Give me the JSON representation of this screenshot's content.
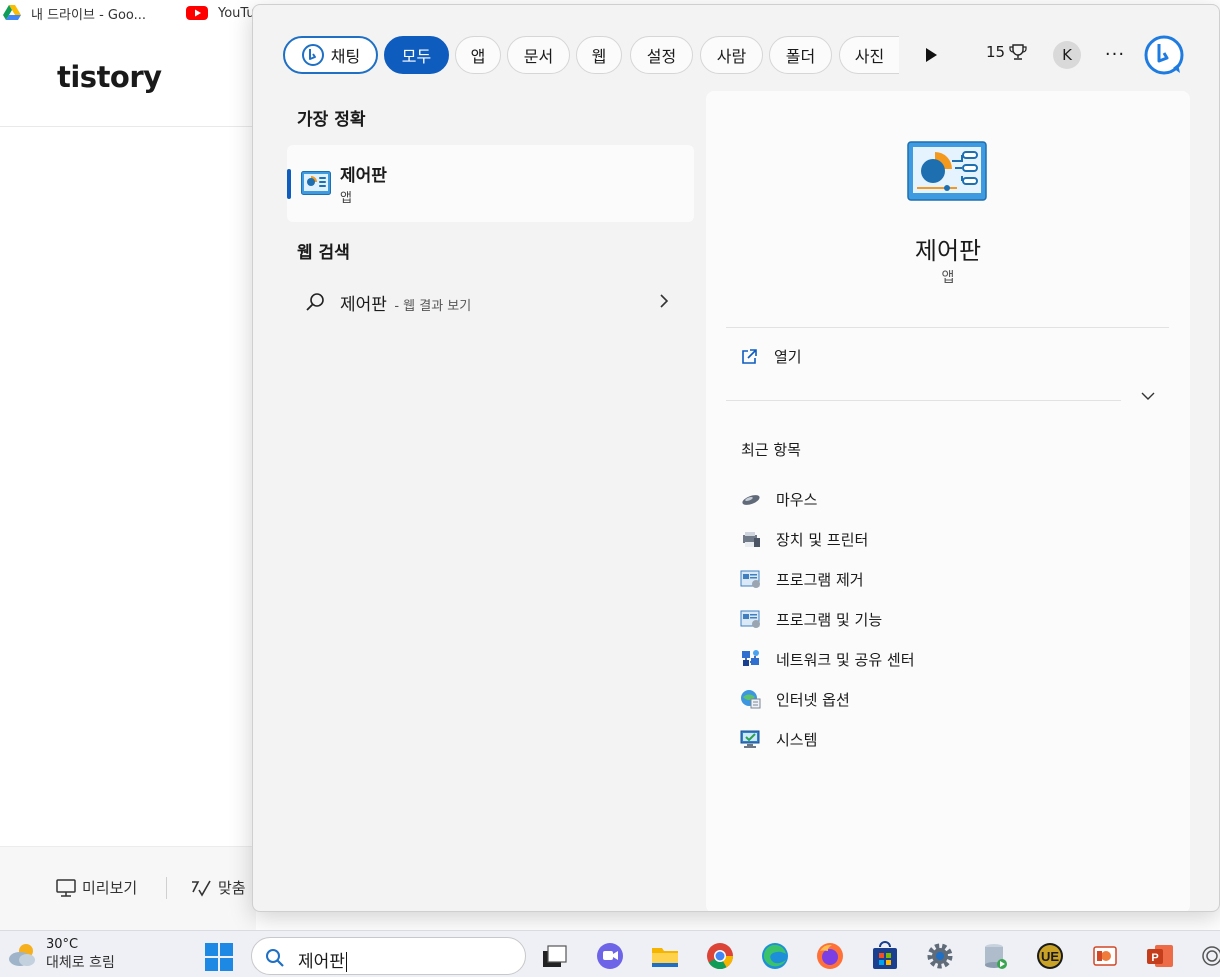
{
  "browser": {
    "bookmarks": [
      {
        "label": "내 드라이브 - Goo...",
        "icon": "google-drive-icon"
      },
      {
        "label": "YouTu",
        "icon": "youtube-icon"
      }
    ],
    "site_logo": "tistory",
    "footer": {
      "preview_label": "미리보기",
      "spellcheck_label": "맞춤"
    }
  },
  "search_panel": {
    "filters": {
      "chat": "채팅",
      "all": "모두",
      "apps": "앱",
      "documents": "문서",
      "web": "웹",
      "settings": "설정",
      "people": "사람",
      "folders": "폴더",
      "photos": "사진"
    },
    "reward_points": "15",
    "account_initial": "K",
    "more_label": "···",
    "best_match_title": "가장 정확",
    "best_match": {
      "name": "제어판",
      "type": "앱"
    },
    "web_search_title": "웹 검색",
    "web_search": {
      "query": "제어판",
      "suffix": "- 웹 결과 보기"
    },
    "preview": {
      "name": "제어판",
      "type": "앱",
      "open_label": "열기",
      "recent_title": "최근 항목",
      "recent_items": [
        {
          "label": "마우스",
          "icon": "mouse-icon"
        },
        {
          "label": "장치 및 프린터",
          "icon": "devices-printers-icon"
        },
        {
          "label": "프로그램 제거",
          "icon": "uninstall-program-icon"
        },
        {
          "label": "프로그램 및 기능",
          "icon": "programs-features-icon"
        },
        {
          "label": "네트워크 및 공유 센터",
          "icon": "network-sharing-icon"
        },
        {
          "label": "인터넷 옵션",
          "icon": "internet-options-icon"
        },
        {
          "label": "시스템",
          "icon": "system-icon"
        }
      ]
    },
    "accent_color": "#0f5cbf"
  },
  "taskbar": {
    "weather": {
      "temp": "30°C",
      "desc": "대체로 흐림"
    },
    "search_text": "제어판",
    "apps": [
      "task-view-icon",
      "teams-chat-icon",
      "file-explorer-icon",
      "chrome-icon",
      "edge-icon",
      "firefox-icon",
      "microsoft-store-icon",
      "settings-icon",
      "database-icon",
      "ue-editor-icon",
      "presentation-app-icon",
      "powerpoint-icon",
      "overflow-icon"
    ]
  }
}
